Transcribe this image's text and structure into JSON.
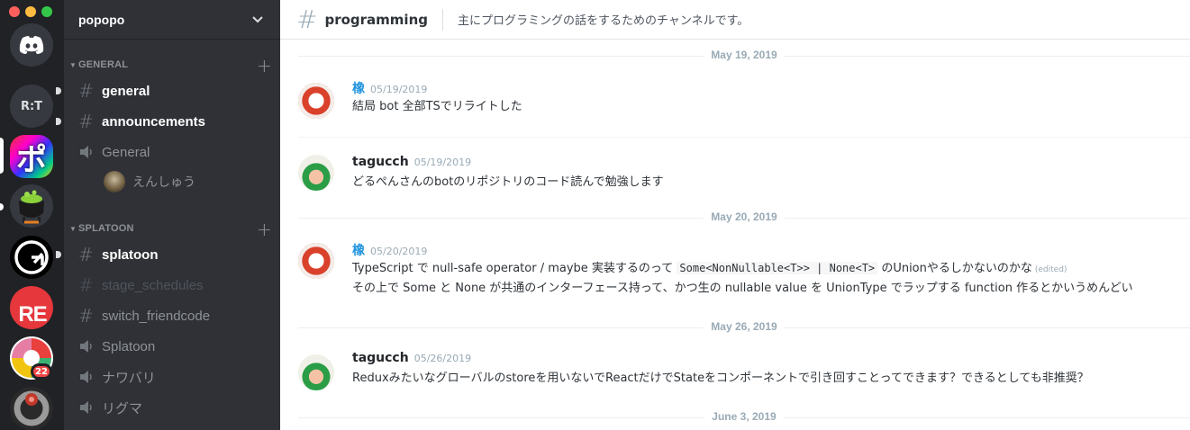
{
  "guild": {
    "name": "popopo"
  },
  "rail": {
    "home_label": "Discord",
    "rt_label": "R:T",
    "popopo_glyph": "ポ",
    "re_label": "RE",
    "mention_badge": "22"
  },
  "categories": {
    "general": "GENERAL",
    "splatoon": "SPLATOON"
  },
  "channels": {
    "general": "general",
    "announcements": "announcements",
    "voice_general": "General",
    "voice_user": "えんしゅう",
    "splatoon": "splatoon",
    "stage_schedules": "stage_schedules",
    "switch_friendcode": "switch_friendcode",
    "voice_splatoon": "Splatoon",
    "voice_nawabari": "ナワバリ",
    "voice_rigma": "リグマ"
  },
  "header": {
    "channel": "programming",
    "topic": "主にプログラミングの話をするためのチャンネルです。"
  },
  "dates": [
    "May 19, 2019",
    "May 20, 2019",
    "May 26, 2019",
    "June 3, 2019"
  ],
  "messages": [
    {
      "author": "橡",
      "time": "05/19/2019",
      "lines": [
        "結局 bot 全部TSでリライトした"
      ]
    },
    {
      "author": "tagucch",
      "time": "05/19/2019",
      "lines": [
        "どるぺんさんのbotのリポジトリのコード読んで勉強します"
      ]
    },
    {
      "author": "橡",
      "time": "05/20/2019",
      "line1_pre": "TypeScript で null-safe operator / maybe 実装するのって",
      "line1_code": "Some<NonNullable<T>> | None<T>",
      "line1_post": "のUnionやるしかないのかな",
      "edited": "(edited)",
      "line2": "その上で Some と None が共通のインターフェース持って、かつ生の nullable value を UnionType でラップする function 作るとかいうめんどい"
    },
    {
      "author": "tagucch",
      "time": "05/26/2019",
      "lines": [
        "Reduxみたいなグローバルのstoreを用いないでReactだけでStateをコンポーネントで引き回すことってできます？できるとしても非推奨？"
      ]
    }
  ],
  "colors": {
    "rail_bg": "#202225",
    "sidebar_bg": "#2f3136",
    "author_blue": "#1f94de",
    "badge_red": "#f04747"
  }
}
